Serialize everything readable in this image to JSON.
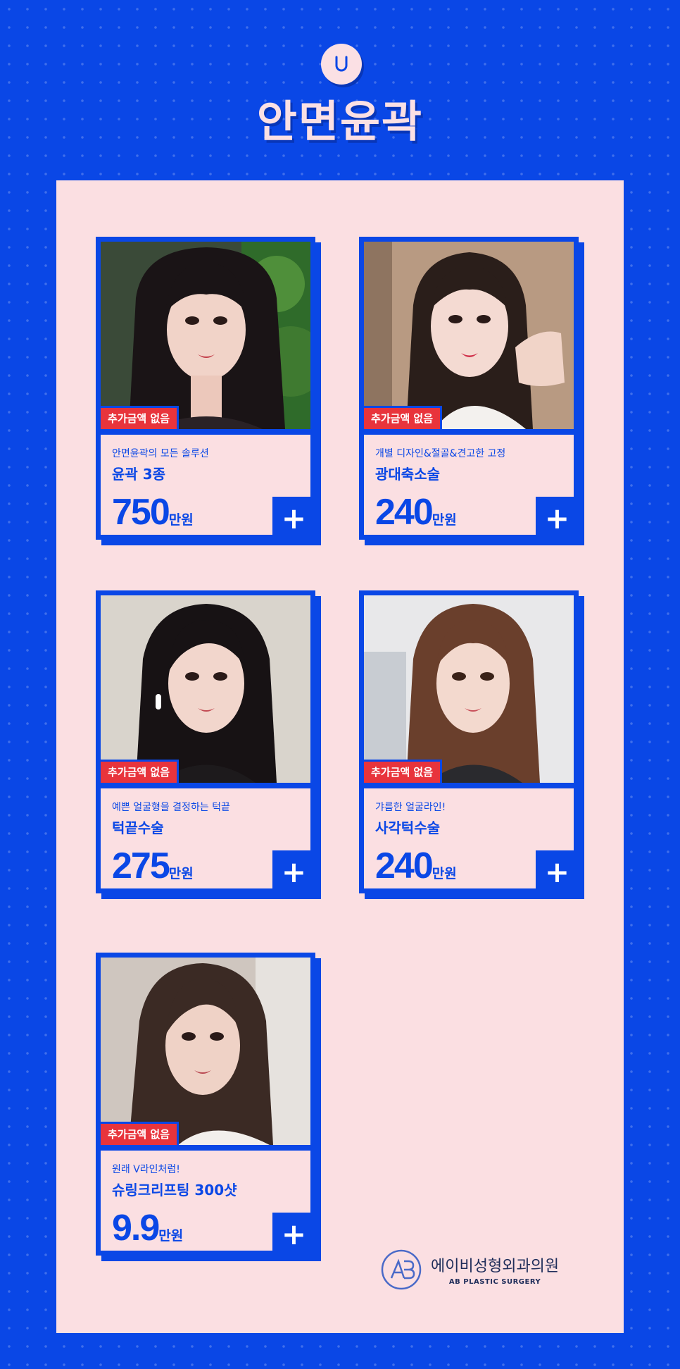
{
  "header": {
    "badge_letter": "U",
    "title": "안면윤곽"
  },
  "cards": [
    {
      "tag": "추가금액 없음",
      "desc": "안면윤곽의 모든 솔루션",
      "name": "윤곽 3종",
      "price": "750",
      "unit": "만원",
      "plus": "+"
    },
    {
      "tag": "추가금액 없음",
      "desc": "개별 디자인&절골&견고한 고정",
      "name": "광대축소술",
      "price": "240",
      "unit": "만원",
      "plus": "+"
    },
    {
      "tag": "추가금액 없음",
      "desc": "예쁜 얼굴형을 결정하는 턱끝",
      "name": "턱끝수술",
      "price": "275",
      "unit": "만원",
      "plus": "+"
    },
    {
      "tag": "추가금액 없음",
      "desc": "갸름한 얼굴라인!",
      "name": "사각턱수술",
      "price": "240",
      "unit": "만원",
      "plus": "+"
    },
    {
      "tag": "추가금액 없음",
      "desc": "원래 V라인처럼!",
      "name": "슈링크리프팅 300샷",
      "price": "9.9",
      "unit": "만원",
      "plus": "+"
    }
  ],
  "logo": {
    "name": "에이비성형외과의원",
    "sub": "AB PLASTIC SURGERY"
  },
  "colors": {
    "brand_blue": "#0a47e6",
    "panel_pink": "#fbdfe2",
    "tag_red": "#e8343c"
  }
}
